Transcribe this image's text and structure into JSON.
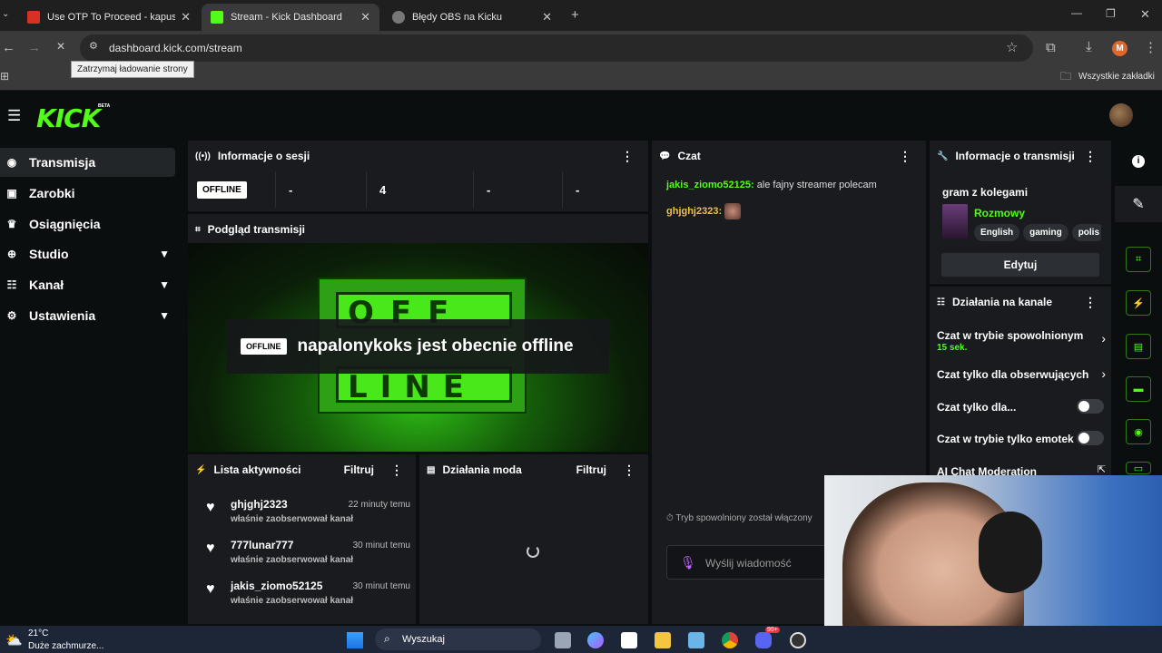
{
  "browser": {
    "tabs": [
      {
        "title": "Use OTP To Proceed - kapustak",
        "icon": "gmail-icon",
        "color": "#d93025",
        "active": false
      },
      {
        "title": "Stream - Kick Dashboard",
        "icon": "kick-icon",
        "color": "#53fc18",
        "active": true
      },
      {
        "title": "Błędy OBS na Kicku",
        "icon": "globe-icon",
        "color": "#aaaaaa",
        "active": false
      }
    ],
    "url": "dashboard.kick.com/stream",
    "tooltip": "Zatrzymaj ładowanie strony",
    "profile_initial": "M",
    "bookmarks_folder": "Wszystkie zakładki"
  },
  "app": {
    "logo": "KICK",
    "logo_badge": "BETA",
    "accent": "#53fc18",
    "nav": [
      {
        "label": "Transmisja",
        "icon": "broadcast-icon",
        "active": true,
        "expandable": false
      },
      {
        "label": "Zarobki",
        "icon": "wallet-icon",
        "active": false,
        "expandable": false
      },
      {
        "label": "Osiągnięcia",
        "icon": "trophy-icon",
        "active": false,
        "expandable": false
      },
      {
        "label": "Studio",
        "icon": "studio-icon",
        "active": false,
        "expandable": true
      },
      {
        "label": "Kanał",
        "icon": "users-icon",
        "active": false,
        "expandable": true
      },
      {
        "label": "Ustawienia",
        "icon": "gear-icon",
        "active": false,
        "expandable": true
      }
    ],
    "session": {
      "title": "Informacje o sesji",
      "status": "OFFLINE",
      "stats": [
        "-",
        "4",
        "-",
        "-"
      ]
    },
    "preview": {
      "title": "Podgląd transmisji",
      "badge": "OFFLINE",
      "message": "napalonykoks jest obecnie offline",
      "screen_text_top": "OFF",
      "screen_text_bottom": "LINE"
    },
    "activity": {
      "title": "Lista aktywności",
      "filter": "Filtruj",
      "items": [
        {
          "name": "ghjghj2323",
          "time": "22 minuty temu",
          "desc": "właśnie zaobserwował kanał"
        },
        {
          "name": "777lunar777",
          "time": "30 minut temu",
          "desc": "właśnie zaobserwował kanał"
        },
        {
          "name": "jakis_ziomo52125",
          "time": "30 minut temu",
          "desc": "właśnie zaobserwował kanał"
        }
      ]
    },
    "mod": {
      "title": "Działania moda",
      "filter": "Filtruj"
    },
    "chat": {
      "title": "Czat",
      "messages": [
        {
          "user": "jakis_ziomo52125:",
          "text": "ale fajny streamer polecam",
          "color": "#53fc18"
        },
        {
          "user": "ghjghj2323:",
          "text": "",
          "color": "#f0c040"
        }
      ],
      "slow_notice": "Tryb spowolniony został włączony",
      "placeholder": "Wyślij wiadomość"
    },
    "stream_info": {
      "title": "Informacje o transmisji",
      "stream_title": "gram z kolegami",
      "category": "Rozmowy",
      "tags": [
        "English",
        "gaming",
        "polis"
      ],
      "edit": "Edytuj"
    },
    "channel_actions": {
      "title": "Działania na kanale",
      "items": [
        {
          "label": "Czat w trybie spowolnionym",
          "sub": "15 sek.",
          "type": "link"
        },
        {
          "label": "Czat tylko dla obserwujących",
          "sub": "",
          "type": "link"
        },
        {
          "label": "Czat tylko dla...",
          "sub": "",
          "type": "toggle"
        },
        {
          "label": "Czat w trybie tylko emotek",
          "sub": "",
          "type": "toggle"
        },
        {
          "label": "AI Chat Moderation",
          "sub": "",
          "type": "external"
        }
      ]
    }
  },
  "taskbar": {
    "temp": "21°C",
    "weather": "Duże zachmurze...",
    "search": "Wyszukaj",
    "notif_count": "99+"
  }
}
